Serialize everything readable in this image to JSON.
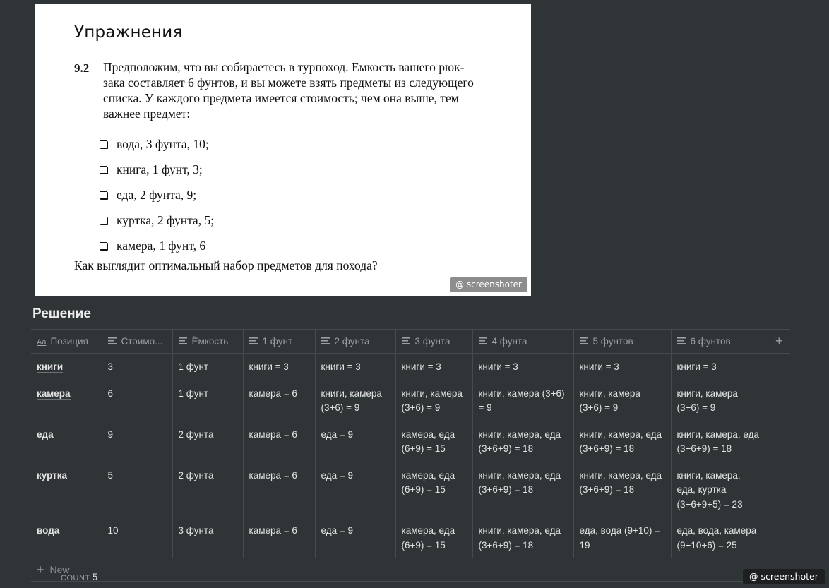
{
  "book": {
    "heading": "Упражнения",
    "exercise_number": "9.2",
    "lines": [
      "Предположим, что вы собираетесь в турпоход. Емкость вашего рюк-",
      "зака составляет 6 фунтов, и вы можете взять предметы из следующего",
      "списка. У каждого предмета имеется стоимость; чем она выше, тем",
      "важнее предмет:"
    ],
    "items": [
      "вода, 3 фунта, 10;",
      "книга, 1 фунт, 3;",
      "еда, 2 фунта, 9;",
      "куртка, 2 фунта, 5;",
      "камера, 1 фунт, 6"
    ],
    "question": "Как выглядит оптимальный набор предметов для похода?",
    "watermark": "@ screenshoter"
  },
  "section_title": "Решение",
  "table": {
    "aa_icon": "Aa",
    "columns": [
      "Позиция",
      "Стоимо...",
      "Ёмкость",
      "1 фунт",
      "2 фунта",
      "3 фунта",
      "4 фунта",
      "5 фунтов",
      "6 фунтов"
    ],
    "add_column": "+",
    "rows": [
      {
        "name": "книги",
        "cost": "3",
        "cap": "1 фунт",
        "c1": "книги = 3",
        "c2": "книги = 3",
        "c3": "книги = 3",
        "c4": "книги = 3",
        "c5": "книги = 3",
        "c6": "книги = 3"
      },
      {
        "name": "камера",
        "cost": "6",
        "cap": "1 фунт",
        "c1": "камера = 6",
        "c2": "книги, камера (3+6) = 9",
        "c3": "книги, камера (3+6) = 9",
        "c4": "книги, камера (3+6) = 9",
        "c5": "книги, камера (3+6) = 9",
        "c6": "книги, камера (3+6) = 9"
      },
      {
        "name": "еда",
        "cost": "9",
        "cap": "2 фунта",
        "c1": "камера = 6",
        "c2": "еда = 9",
        "c3": "камера, еда (6+9) = 15",
        "c4": "книги, камера, еда (3+6+9) = 18",
        "c5": "книги, камера, еда (3+6+9) = 18",
        "c6": "книги, камера, еда (3+6+9) = 18"
      },
      {
        "name": "куртка",
        "cost": "5",
        "cap": "2 фунта",
        "c1": "камера = 6",
        "c2": "еда = 9",
        "c3": "камера, еда (6+9) = 15",
        "c4": "книги, камера, еда (3+6+9) = 18",
        "c5": "книги, камера, еда (3+6+9) = 18",
        "c6": "книги, камера, еда, куртка (3+6+9+5) = 23"
      },
      {
        "name": "вода",
        "cost": "10",
        "cap": "3 фунта",
        "c1": "камера = 6",
        "c2": "еда = 9",
        "c3": "камера, еда (6+9) = 15",
        "c4": "книги, камера, еда (3+6+9) = 18",
        "c5": "еда, вода (9+10) = 19",
        "c6": "еда, вода, камера (9+10+6) = 25"
      }
    ],
    "new_label": "New",
    "count_label": "COUNT",
    "count_value": "5"
  },
  "watermark": "@ screenshoter"
}
